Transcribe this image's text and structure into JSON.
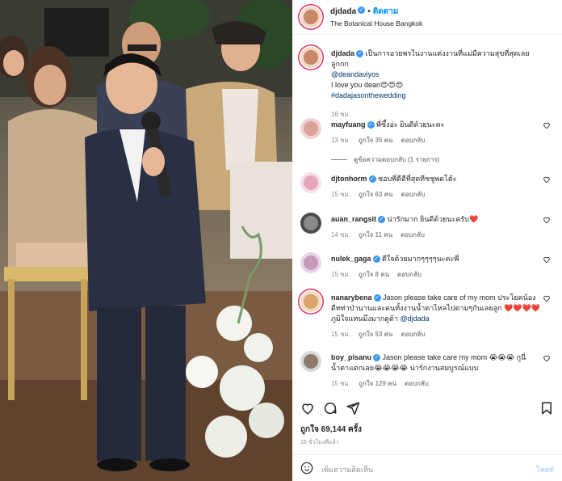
{
  "post": {
    "username": "djdada",
    "follow_label": "ติดตาม",
    "location": "The Botanical House Bangkok",
    "caption": {
      "username": "djdada",
      "text": "เป็นการอวยพรในงานแต่งงานที่แม่มีความสุขที่สุดเลยลูกกก",
      "mention": "@deandaviyos",
      "line2": "I love you dean😍😍😍",
      "hashtag": "#dadajasonthewedding",
      "time": "16 ชม."
    },
    "likes": "ถูกใจ 69,144 ครั้ง",
    "posted_ago": "16 ชั่วโมงที่แล้ว",
    "add_comment_placeholder": "เพิ่มความคิดเห็น",
    "post_label": "โพสต์"
  },
  "comments": [
    {
      "username": "mayfuang",
      "text": "พี่ซึ้งอ่ะ ยินดีด้วยนะคะ",
      "time": "13 ชม.",
      "likes": "ถูกใจ 35 คน",
      "reply": "ตอบกลับ",
      "view_replies": "ดูข้อความตอบกลับ (1 รายการ)"
    },
    {
      "username": "djtonhorm",
      "text": "ชอบพี่ดีดีที่สุดทีชชูพดโต้ะ",
      "time": "15 ชม.",
      "likes": "ถูกใจ 63 คน",
      "reply": "ตอบกลับ"
    },
    {
      "username": "auan_rangsit",
      "text": "น่ารักมาก ยินดีด้วยนะครับ❤️",
      "time": "14 ชม.",
      "likes": "ถูกใจ 11 คน",
      "reply": "ตอบกลับ"
    },
    {
      "username": "nulek_gaga",
      "text": "ดีใจด้วยมากๆๆๆๆนะคะพี่",
      "time": "15 ชม.",
      "likes": "ถูกใจ 8 คน",
      "reply": "ตอบกลับ"
    },
    {
      "username": "nanarybena",
      "text": "Jason please take care of my mom ประโยคน้องดีทท่าป่านานและคนทั้งงานน้ำตาไหลไปตามๆกันเลยลูก ❤️❤️❤️❤️ ภูมิใจแทนมึงมากดูด้า",
      "mention": "@djdada",
      "time": "15 ชม.",
      "likes": "ถูกใจ 53 คน",
      "reply": "ตอบกลับ"
    },
    {
      "username": "boy_pisanu",
      "text": "Jason please take care my mom 😭😭😭 กูนี่น้ำตาแตกเลย😭😭😭😭 น่ารักงานสมบูรณ์แบบ",
      "time": "15 ชม.",
      "likes": "ถูกใจ 129 คน",
      "reply": "ตอบกลับ"
    }
  ],
  "colors": {
    "link": "#0095f6",
    "verified": "#3897f0",
    "meta": "#8e8e8e",
    "ring": "#e1306c"
  },
  "icons": [
    "heart-icon",
    "comment-icon",
    "share-icon",
    "bookmark-icon",
    "emoji-icon",
    "verified-icon"
  ]
}
